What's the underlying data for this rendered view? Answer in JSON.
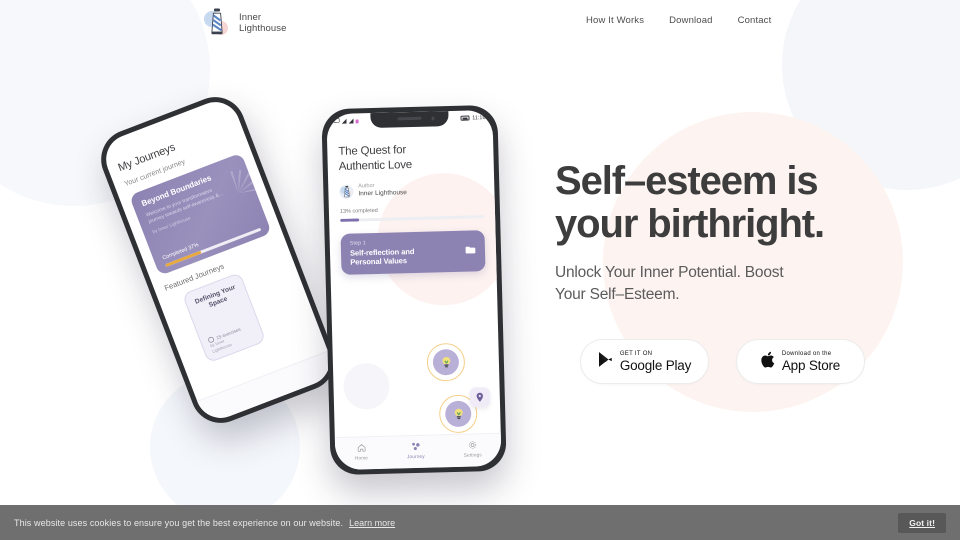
{
  "brand": {
    "name": "Inner\nLighthouse",
    "logo_icon": "lighthouse-icon"
  },
  "nav": {
    "items": [
      {
        "label": "How It Works"
      },
      {
        "label": "Download"
      },
      {
        "label": "Contact"
      }
    ]
  },
  "hero": {
    "title": "Self–esteem is\nyour birthright.",
    "subtitle": "Unlock Your Inner Potential. Boost\nYour Self–Esteem.",
    "stores": [
      {
        "icon": "google-play-icon",
        "top": "GET IT ON",
        "bottom": "Google Play",
        "uppercase": true
      },
      {
        "icon": "apple-icon",
        "top": "Download on the",
        "bottom": "App Store",
        "uppercase": false
      }
    ]
  },
  "phone_front": {
    "status": {
      "time": "11:16",
      "signal_icon": "signal-icon",
      "wifi_icon": "wifi-icon",
      "battery_icon": "battery-icon",
      "message_icon": "message-icon"
    },
    "quest_title": "The Quest for\nAuthentic Love",
    "author_label": "Author",
    "author_name": "Inner Lighthouse",
    "progress_label": "13% completed",
    "progress_percent": 13,
    "step_card": {
      "eyebrow": "Step 1",
      "title": "Self-reflection and\nPersonal Values",
      "icon": "folder-icon"
    },
    "nodes": [
      {
        "icon": "lightbulb-icon"
      },
      {
        "icon": "lightbulb-icon"
      }
    ],
    "pin_badge_icon": "location-pin-icon",
    "tabs": [
      {
        "label": "Home",
        "icon": "home-icon",
        "active": false
      },
      {
        "label": "Journey",
        "icon": "journey-dots-icon",
        "active": true
      },
      {
        "label": "Settings",
        "icon": "gear-icon",
        "active": false
      }
    ]
  },
  "phone_back": {
    "heading": "My Journeys",
    "subheading": "Your current journey",
    "current_card": {
      "title": "Beyond Boundaries",
      "description": "Welcome to your transformative\njourney towards self-awareness &...",
      "byline": "by Inner Lighthouse",
      "progress_label": "Completed 37%",
      "progress_percent": 37
    },
    "featured_heading": "Featured Journeys",
    "featured_card": {
      "title": "Defining Your\nSpace",
      "meta": "15 exercises",
      "meta_icon": "badge-icon",
      "byline": "by Inner\nLighthouse"
    }
  },
  "cookie": {
    "message": "This website uses cookies to ensure you get the best experience on our website.",
    "link": "Learn more",
    "button": "Got it!"
  },
  "colors": {
    "purple": "#8d83b3",
    "gold": "#e8a93c",
    "pink_blob": "#fdf4f1",
    "blue_blob": "#f6f8fb",
    "text_dark": "#3d3d3d",
    "cookie_bg": "#6f6f6f"
  }
}
